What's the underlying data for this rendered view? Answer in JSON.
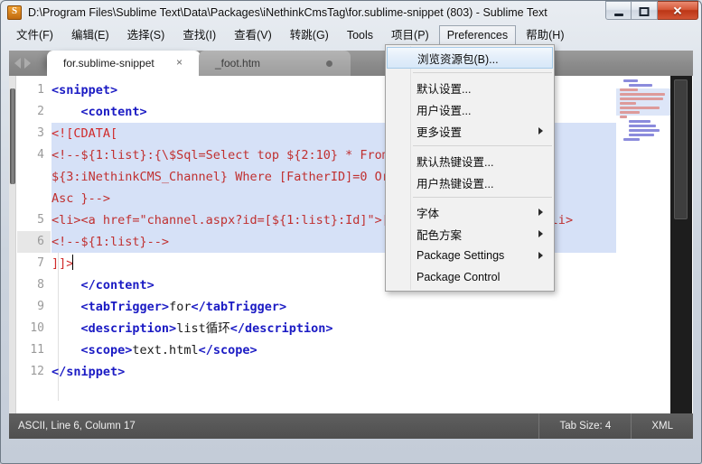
{
  "window": {
    "title": "D:\\Program Files\\Sublime Text\\Data\\Packages\\iNethinkCmsTag\\for.sublime-snippet (803) - Sublime Text",
    "icon": "sublime-text-icon",
    "minimize_glyph": "minimize-icon",
    "maximize_glyph": "maximize-icon",
    "close_glyph": "✕"
  },
  "menubar": {
    "items": [
      {
        "label": "文件(F)",
        "name": "menu-file",
        "open": false
      },
      {
        "label": "编辑(E)",
        "name": "menu-edit",
        "open": false
      },
      {
        "label": "选择(S)",
        "name": "menu-selection",
        "open": false
      },
      {
        "label": "查找(I)",
        "name": "menu-find",
        "open": false
      },
      {
        "label": "查看(V)",
        "name": "menu-view",
        "open": false
      },
      {
        "label": "转跳(G)",
        "name": "menu-goto",
        "open": false
      },
      {
        "label": "Tools",
        "name": "menu-tools",
        "open": false
      },
      {
        "label": "项目(P)",
        "name": "menu-project",
        "open": false
      },
      {
        "label": "Preferences",
        "name": "menu-preferences",
        "open": true
      },
      {
        "label": "帮助(H)",
        "name": "menu-help",
        "open": false
      }
    ]
  },
  "dropdown": {
    "owner": "Preferences",
    "items": [
      {
        "label": "浏览资源包(B)...",
        "name": "menu-browse-packages",
        "highlight": true,
        "submenu": false,
        "separator_after": true
      },
      {
        "label": "默认设置...",
        "name": "menu-settings-default",
        "highlight": false,
        "submenu": false,
        "separator_after": false
      },
      {
        "label": "用户设置...",
        "name": "menu-settings-user",
        "highlight": false,
        "submenu": false,
        "separator_after": false
      },
      {
        "label": "更多设置",
        "name": "menu-settings-more",
        "highlight": false,
        "submenu": true,
        "separator_after": true
      },
      {
        "label": "默认热键设置...",
        "name": "menu-keybindings-default",
        "highlight": false,
        "submenu": false,
        "separator_after": false
      },
      {
        "label": "用户热键设置...",
        "name": "menu-keybindings-user",
        "highlight": false,
        "submenu": false,
        "separator_after": true
      },
      {
        "label": "字体",
        "name": "menu-font",
        "highlight": false,
        "submenu": true,
        "separator_after": false
      },
      {
        "label": "配色方案",
        "name": "menu-color-scheme",
        "highlight": false,
        "submenu": true,
        "separator_after": false
      },
      {
        "label": "Package Settings",
        "name": "menu-package-settings",
        "highlight": false,
        "submenu": true,
        "separator_after": false
      },
      {
        "label": "Package Control",
        "name": "menu-package-control",
        "highlight": false,
        "submenu": false,
        "separator_after": false
      }
    ]
  },
  "tabs": {
    "nav_back": "nav-back-arrow",
    "nav_forward": "nav-forward-arrow",
    "items": [
      {
        "label": "for.sublime-snippet",
        "name": "tab-for-sublime-snippet",
        "active": true,
        "dirty": false,
        "close": "×"
      },
      {
        "label": "_foot.htm",
        "name": "tab-foot-htm",
        "active": false,
        "dirty": true,
        "close": "×"
      }
    ]
  },
  "editor": {
    "gutter_numbers": [
      "1",
      "2",
      "3",
      "4",
      "5",
      "6",
      "7",
      "8",
      "9",
      "10",
      "11",
      "12"
    ],
    "active_line": 6,
    "lines": [
      "<snippet>",
      "    <content>",
      "<![CDATA[",
      "<!--${1:list}:{\\$Sql=Select top ${2:10} * From ${3:iNethinkCMS_Channel} Where [FatherID]=0 Order By Sort Asc,Id Asc }-->",
      "<li><a href=\"channel.aspx?id=[${1:list}:Id]\">[${1:list}:Title]</a></li>",
      "<!--${1:list}-->",
      "]]>",
      "    </content>",
      "    <tabTrigger>for</tabTrigger>",
      "    <description>list循环</description>",
      "    <scope>text.html</scope>",
      "</snippet>"
    ],
    "visual_rows": [
      {
        "num": "1",
        "segments": [
          {
            "t": "<",
            "c": "tag"
          },
          {
            "t": "snippet",
            "c": "tag"
          },
          {
            "t": ">",
            "c": "tag"
          }
        ],
        "selected": false
      },
      {
        "num": "2",
        "segments": [
          {
            "t": "    ",
            "c": "txt"
          },
          {
            "t": "<content>",
            "c": "tag"
          }
        ],
        "selected": false
      },
      {
        "num": "3",
        "segments": [
          {
            "t": "<![CDATA[",
            "c": "cdata"
          }
        ],
        "selected": true
      },
      {
        "num": "4",
        "segments": [
          {
            "t": "<!--${1:list}:{\\$Sql=Select top ${2:10} * From",
            "c": "cmt"
          }
        ],
        "selected": true
      },
      {
        "num": "",
        "segments": [
          {
            "t": "${3:iNethinkCMS_Channel} Where [FatherID]=0 Order By Sort Asc,Id",
            "c": "cmt"
          }
        ],
        "selected": true
      },
      {
        "num": "",
        "segments": [
          {
            "t": "Asc }-->",
            "c": "cmt"
          }
        ],
        "selected": true
      },
      {
        "num": "5",
        "segments": [
          {
            "t": "<li><a href=\"channel.aspx?id=[${1:list}:Id]\">[${1:list}:Title]</a></li>",
            "c": "cmt"
          }
        ],
        "selected": true
      },
      {
        "num": "6",
        "segments": [
          {
            "t": "<!--${1:list}-->",
            "c": "cmt"
          }
        ],
        "selected": true
      },
      {
        "num": "7",
        "segments": [
          {
            "t": "]]>",
            "c": "cdata"
          }
        ],
        "selected": false
      },
      {
        "num": "8",
        "segments": [
          {
            "t": "    ",
            "c": "txt"
          },
          {
            "t": "</content>",
            "c": "tag"
          }
        ],
        "selected": false
      },
      {
        "num": "9",
        "segments": [
          {
            "t": "    ",
            "c": "txt"
          },
          {
            "t": "<tabTrigger>",
            "c": "tag"
          },
          {
            "t": "for",
            "c": "txt"
          },
          {
            "t": "</tabTrigger>",
            "c": "tag"
          }
        ],
        "selected": false
      },
      {
        "num": "10",
        "segments": [
          {
            "t": "    ",
            "c": "txt"
          },
          {
            "t": "<description>",
            "c": "tag"
          },
          {
            "t": "list循环",
            "c": "txt"
          },
          {
            "t": "</description>",
            "c": "tag"
          }
        ],
        "selected": false
      },
      {
        "num": "11",
        "segments": [
          {
            "t": "    ",
            "c": "txt"
          },
          {
            "t": "<scope>",
            "c": "tag"
          },
          {
            "t": "text.html",
            "c": "txt"
          },
          {
            "t": "</scope>",
            "c": "tag"
          }
        ],
        "selected": false
      },
      {
        "num": "12",
        "segments": [
          {
            "t": "</snippet>",
            "c": "tag"
          }
        ],
        "selected": false
      }
    ]
  },
  "statusbar": {
    "position": "ASCII, Line 6, Column 17",
    "tab_size": "Tab Size: 4",
    "syntax": "XML"
  },
  "colors": {
    "selection": "#d6e1f7",
    "tag": "#1b1bc4",
    "comment": "#c03030",
    "menu_highlight": "#dceafa",
    "statusbar_bg": "#575757",
    "tabbar_bg": "#8c8c8c"
  }
}
